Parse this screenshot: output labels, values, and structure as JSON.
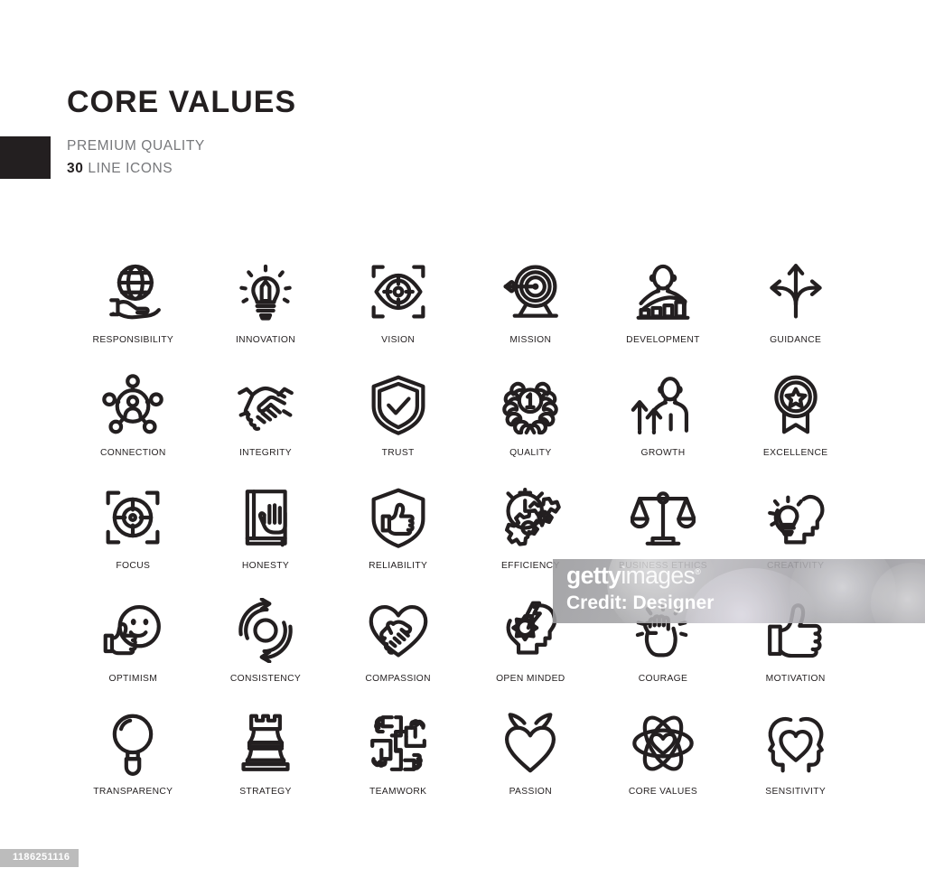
{
  "header": {
    "title": "CORE VALUES",
    "subtitle": "PREMIUM QUALITY",
    "count": "30",
    "count_suffix": " LINE ICONS",
    "accent_color": "#231f20",
    "subtitle_color": "#77787b"
  },
  "watermark": {
    "logo_bold": "getty",
    "logo_light": "images",
    "registered": "®",
    "credit": "Credit: Designer"
  },
  "footer": {
    "asset_id": "1186251116"
  },
  "grid": {
    "columns": 6,
    "rows": 5,
    "icon_count": 30,
    "icons": [
      {
        "id": "responsibility",
        "label": "RESPONSIBILITY"
      },
      {
        "id": "innovation",
        "label": "INNOVATION"
      },
      {
        "id": "vision",
        "label": "VISION"
      },
      {
        "id": "mission",
        "label": "MISSION"
      },
      {
        "id": "development",
        "label": "DEVELOPMENT"
      },
      {
        "id": "guidance",
        "label": "GUIDANCE"
      },
      {
        "id": "connection",
        "label": "CONNECTION"
      },
      {
        "id": "integrity",
        "label": "INTEGRITY"
      },
      {
        "id": "trust",
        "label": "TRUST"
      },
      {
        "id": "quality",
        "label": "QUALITY"
      },
      {
        "id": "growth",
        "label": "GROWTH"
      },
      {
        "id": "excellence",
        "label": "EXCELLENCE"
      },
      {
        "id": "focus",
        "label": "FOCUS"
      },
      {
        "id": "honesty",
        "label": "HONESTY"
      },
      {
        "id": "reliability",
        "label": "RELIABILITY"
      },
      {
        "id": "efficiency",
        "label": "EFFICIENCY"
      },
      {
        "id": "business-ethics",
        "label": "BUSINESS ETHICS"
      },
      {
        "id": "creativity",
        "label": "CREATIVITY"
      },
      {
        "id": "optimism",
        "label": "OPTIMISM"
      },
      {
        "id": "consistency",
        "label": "CONSISTENCY"
      },
      {
        "id": "compassion",
        "label": "COMPASSION"
      },
      {
        "id": "open-minded",
        "label": "OPEN MINDED"
      },
      {
        "id": "courage",
        "label": "COURAGE"
      },
      {
        "id": "motivation",
        "label": "MOTIVATION"
      },
      {
        "id": "transparency",
        "label": "TRANSPARENCY"
      },
      {
        "id": "strategy",
        "label": "STRATEGY"
      },
      {
        "id": "teamwork",
        "label": "TEAMWORK"
      },
      {
        "id": "passion",
        "label": "PASSION"
      },
      {
        "id": "core-values",
        "label": "CORE VALUES"
      },
      {
        "id": "sensitivity",
        "label": "SENSITIVITY"
      }
    ]
  }
}
